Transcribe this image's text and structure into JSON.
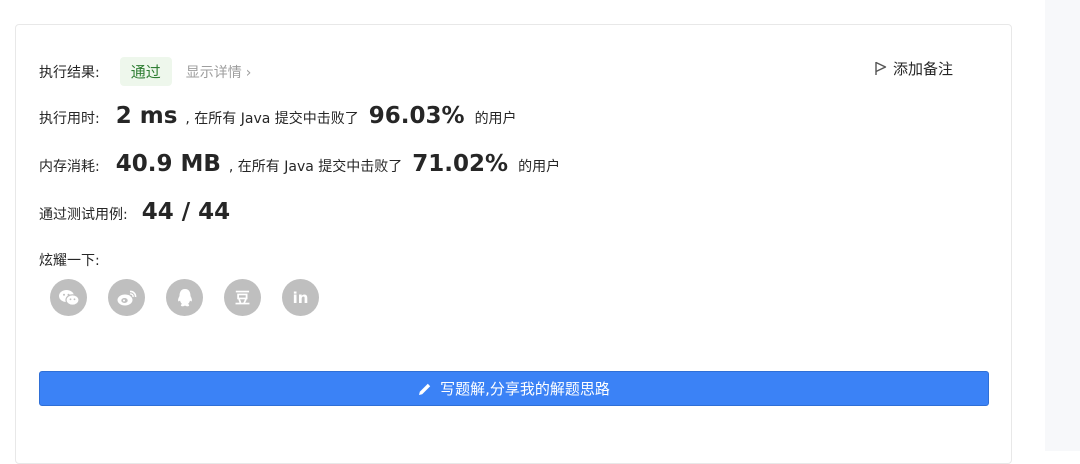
{
  "result": {
    "label": "执行结果:",
    "status": "通过",
    "details_link": "显示详情",
    "details_chevron": "›",
    "add_note": "添加备注"
  },
  "runtime": {
    "label": "执行用时:",
    "value": "2 ms",
    "middle": ", 在所有 Java 提交中击败了",
    "percent": "96.03%",
    "tail": "的用户"
  },
  "memory": {
    "label": "内存消耗:",
    "value": "40.9 MB",
    "middle": ", 在所有 Java 提交中击败了",
    "percent": "71.02%",
    "tail": "的用户"
  },
  "tests": {
    "label": "通过测试用例:",
    "value": "44 / 44"
  },
  "share": {
    "label": "炫耀一下:",
    "icons": [
      "wechat-icon",
      "weibo-icon",
      "qq-icon",
      "douban-icon",
      "linkedin-icon"
    ],
    "douban_glyph": "豆",
    "linkedin_glyph": "in"
  },
  "cta": {
    "label": "写题解,分享我的解题思路"
  },
  "colors": {
    "primary": "#3b82f6",
    "success_text": "#2e7d32",
    "success_bg": "#eef7ec",
    "icon_gray": "#bfbfbf"
  }
}
